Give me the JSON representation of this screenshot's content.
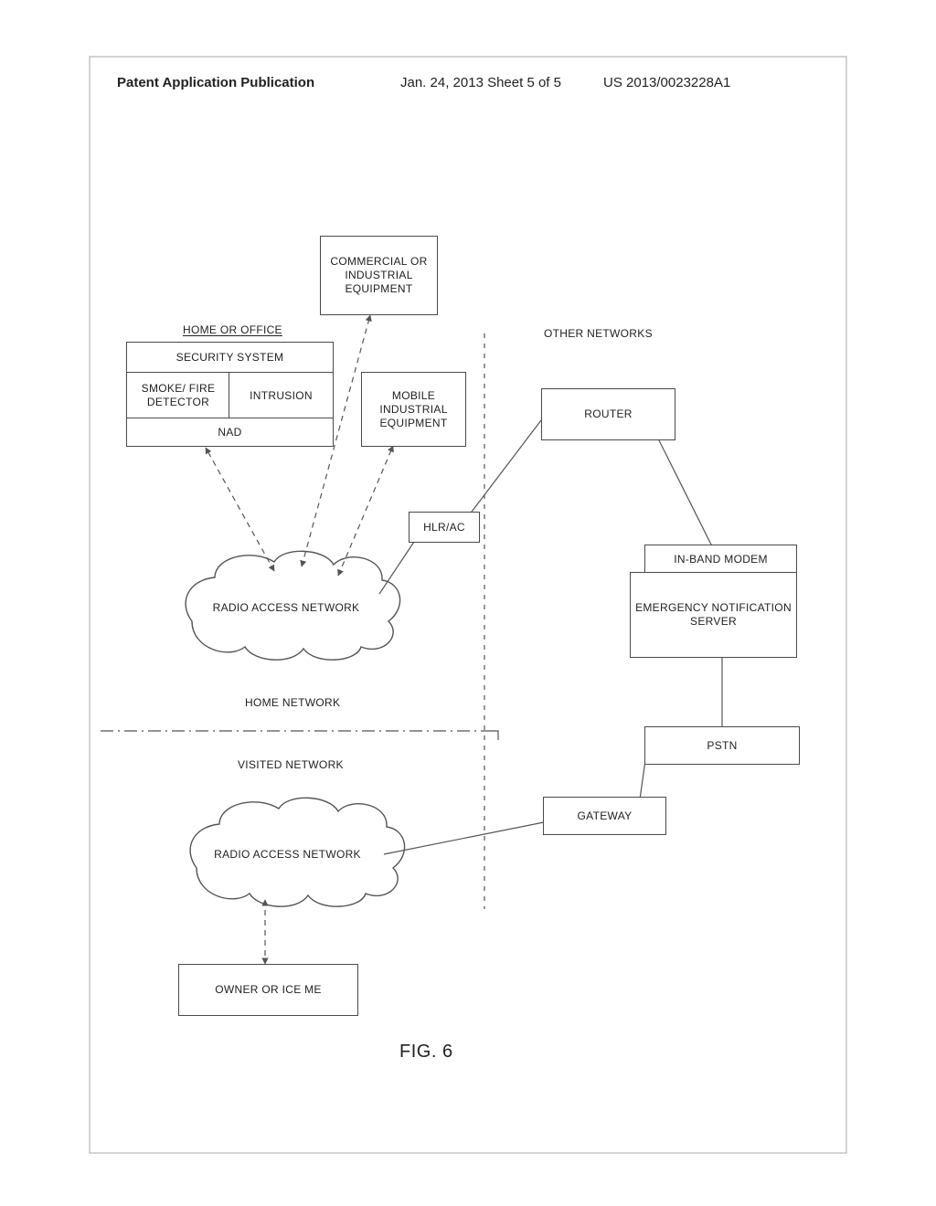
{
  "header": {
    "left": "Patent Application Publication",
    "mid": "Jan. 24, 2013  Sheet 5 of 5",
    "right": "US 2013/0023228A1"
  },
  "labels": {
    "home_or_office": "HOME OR OFFICE",
    "other_networks": "OTHER NETWORKS",
    "home_network": "HOME NETWORK",
    "visited_network": "VISITED NETWORK"
  },
  "nodes": {
    "commercial_equipment": "COMMERCIAL OR INDUSTRIAL EQUIPMENT",
    "security_system": "SECURITY SYSTEM",
    "smoke_fire": "SMOKE/ FIRE DETECTOR",
    "intrusion": "INTRUSION",
    "nad": "NAD",
    "mobile_industrial": "MOBILE INDUSTRIAL EQUIPMENT",
    "router": "ROUTER",
    "hlr_ac": "HLR/AC",
    "ran1": "RADIO ACCESS NETWORK",
    "in_band_modem": "IN-BAND MODEM",
    "emergency_server": "EMERGENCY NOTIFICATION SERVER",
    "pstn": "PSTN",
    "gateway": "GATEWAY",
    "ran2": "RADIO ACCESS NETWORK",
    "owner": "OWNER OR ICE ME"
  },
  "caption": "FIG. 6"
}
